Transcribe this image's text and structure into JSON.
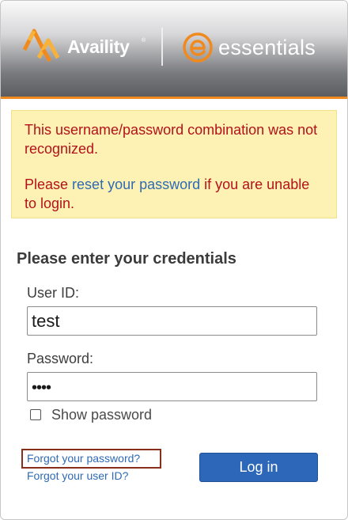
{
  "header": {
    "brand_left": "Availity",
    "brand_left_tm": "®",
    "brand_right": "essentials",
    "accent_color": "#f08a1e"
  },
  "alert": {
    "line1": "This username/password combination was not recognized.",
    "line2_prefix": "Please ",
    "line2_link": "reset your password",
    "line2_suffix": " if you are unable to login.",
    "text_color": "#b4121a",
    "background": "#fdf2b4"
  },
  "form": {
    "title": "Please enter your credentials",
    "user_id_label": "User ID:",
    "user_id_value": "test",
    "password_label": "Password:",
    "password_value": "••••",
    "show_password_label": "Show password",
    "show_password_checked": false
  },
  "links": {
    "forgot_password": "Forgot your password?",
    "forgot_user_id": "Forgot your user ID?"
  },
  "actions": {
    "login_label": "Log in",
    "login_color": "#2d67ba"
  },
  "icons": {
    "availity_logo": "availity-logo-icon",
    "essentials_logo": "essentials-logo-icon"
  }
}
